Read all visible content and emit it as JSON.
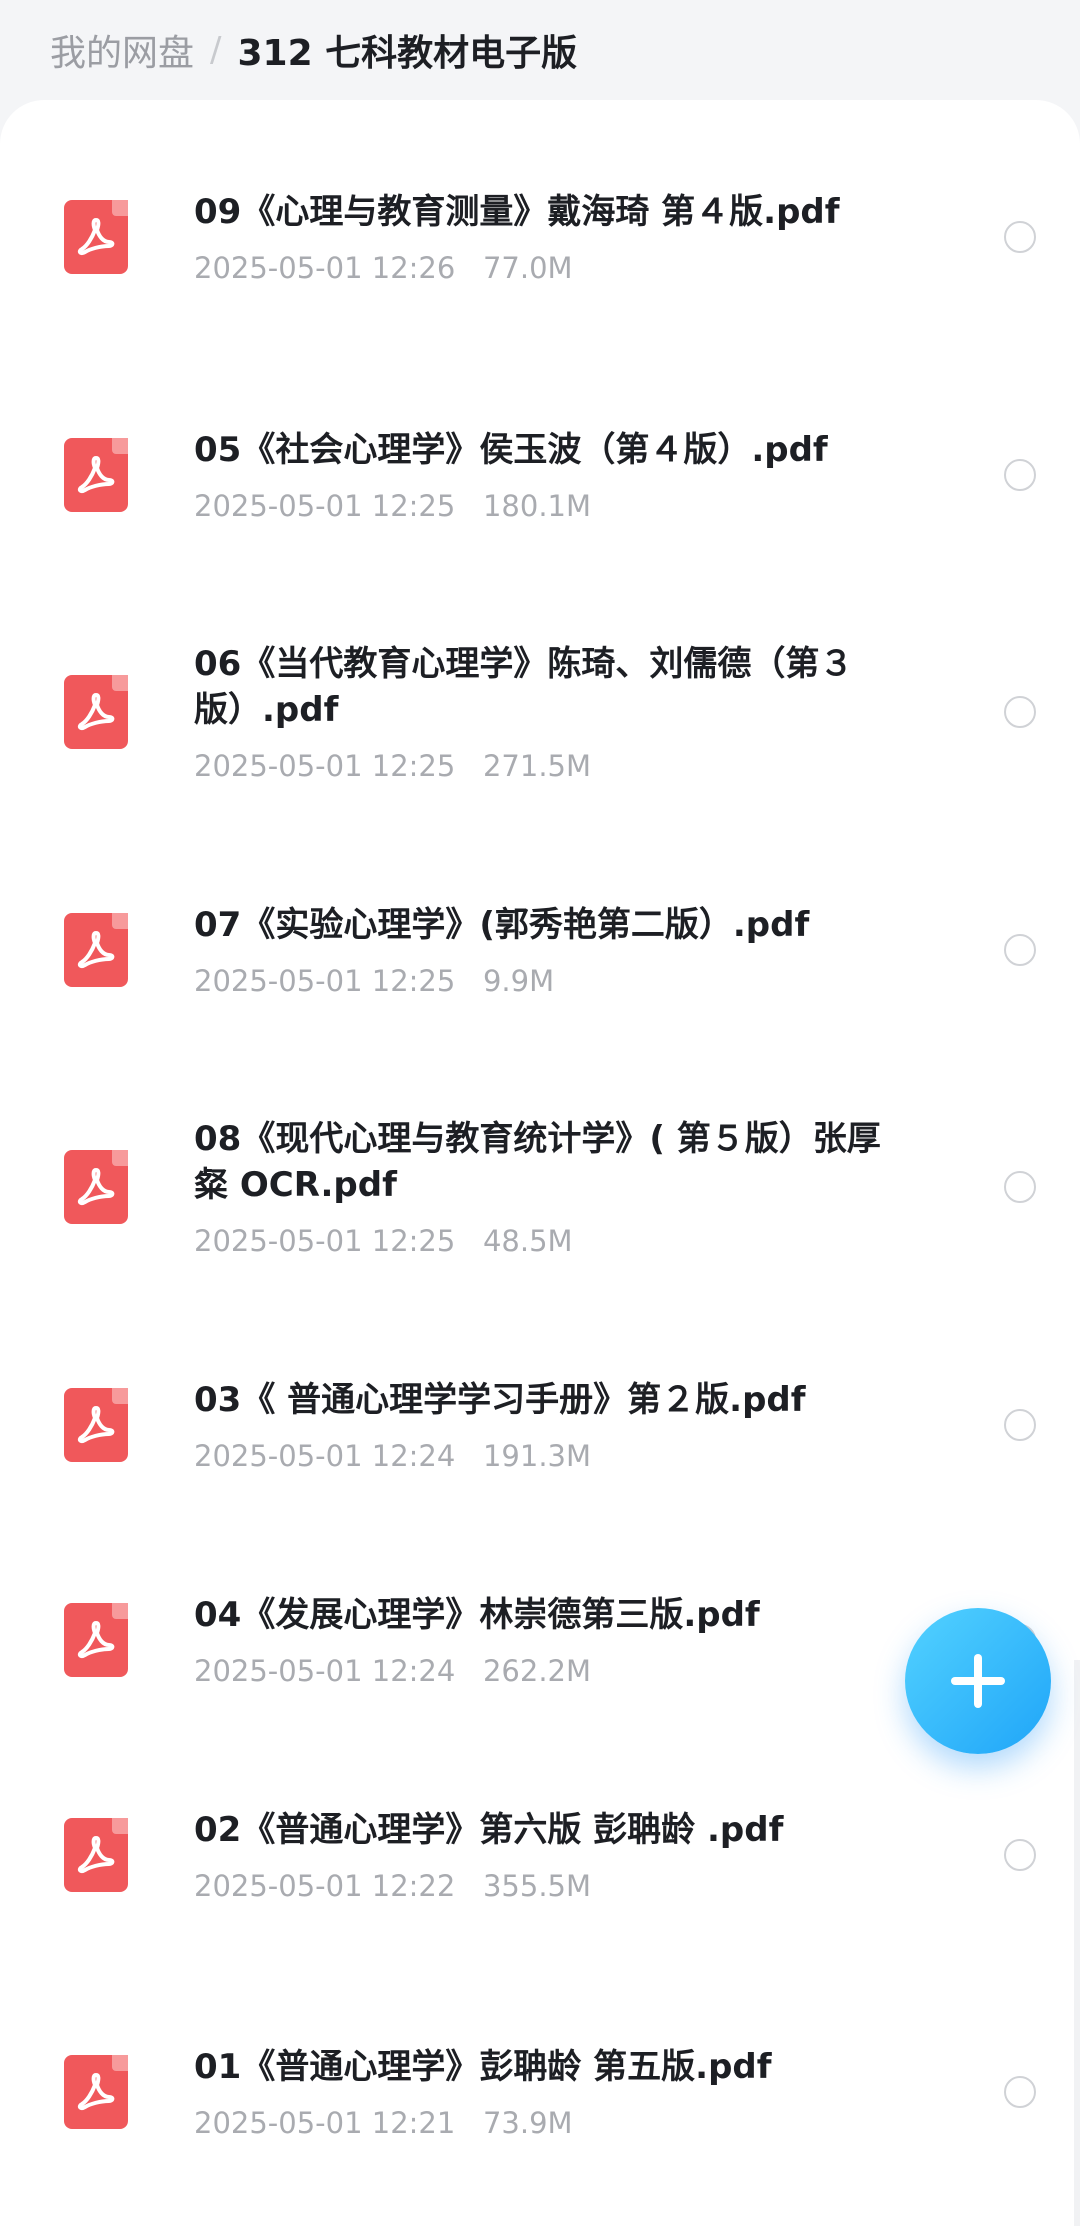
{
  "breadcrumb": {
    "root": "我的网盘",
    "separator": "/",
    "current": "312 七科教材电子版"
  },
  "files": [
    {
      "name": "09《心理与教育测量》戴海琦  第４版.pdf",
      "date": "2025-05-01 12:26",
      "size": "77.0M",
      "icon": "pdf-icon"
    },
    {
      "name": "05《社会心理学》侯玉波（第４版）.pdf",
      "date": "2025-05-01 12:25",
      "size": "180.1M",
      "icon": "pdf-icon"
    },
    {
      "name": "06《当代教育心理学》陈琦、刘儒德（第３版）.pdf",
      "date": "2025-05-01 12:25",
      "size": "271.5M",
      "icon": "pdf-icon"
    },
    {
      "name": "07《实验心理学》(郭秀艳第二版）.pdf",
      "date": "2025-05-01 12:25",
      "size": "9.9M",
      "icon": "pdf-icon"
    },
    {
      "name": "08《现代心理与教育统计学》( 第５版）张厚粲 OCR.pdf",
      "date": "2025-05-01 12:25",
      "size": "48.5M",
      "icon": "pdf-icon"
    },
    {
      "name": "03《 普通心理学学习手册》第２版.pdf",
      "date": "2025-05-01 12:24",
      "size": "191.3M",
      "icon": "pdf-icon"
    },
    {
      "name": "04《发展心理学》林崇德第三版.pdf",
      "date": "2025-05-01 12:24",
      "size": "262.2M",
      "icon": "pdf-icon"
    },
    {
      "name": "02《普通心理学》第六版 彭聃龄 .pdf",
      "date": "2025-05-01 12:22",
      "size": "355.5M",
      "icon": "pdf-icon"
    },
    {
      "name": "01《普通心理学》彭聃龄 第五版.pdf",
      "date": "2025-05-01 12:21",
      "size": "73.9M",
      "icon": "pdf-icon"
    }
  ],
  "fab": {
    "icon": "plus-icon",
    "color": "#2ab4fb"
  },
  "colors": {
    "pdf": "#f0585b",
    "accent": "#2ab4fb"
  }
}
